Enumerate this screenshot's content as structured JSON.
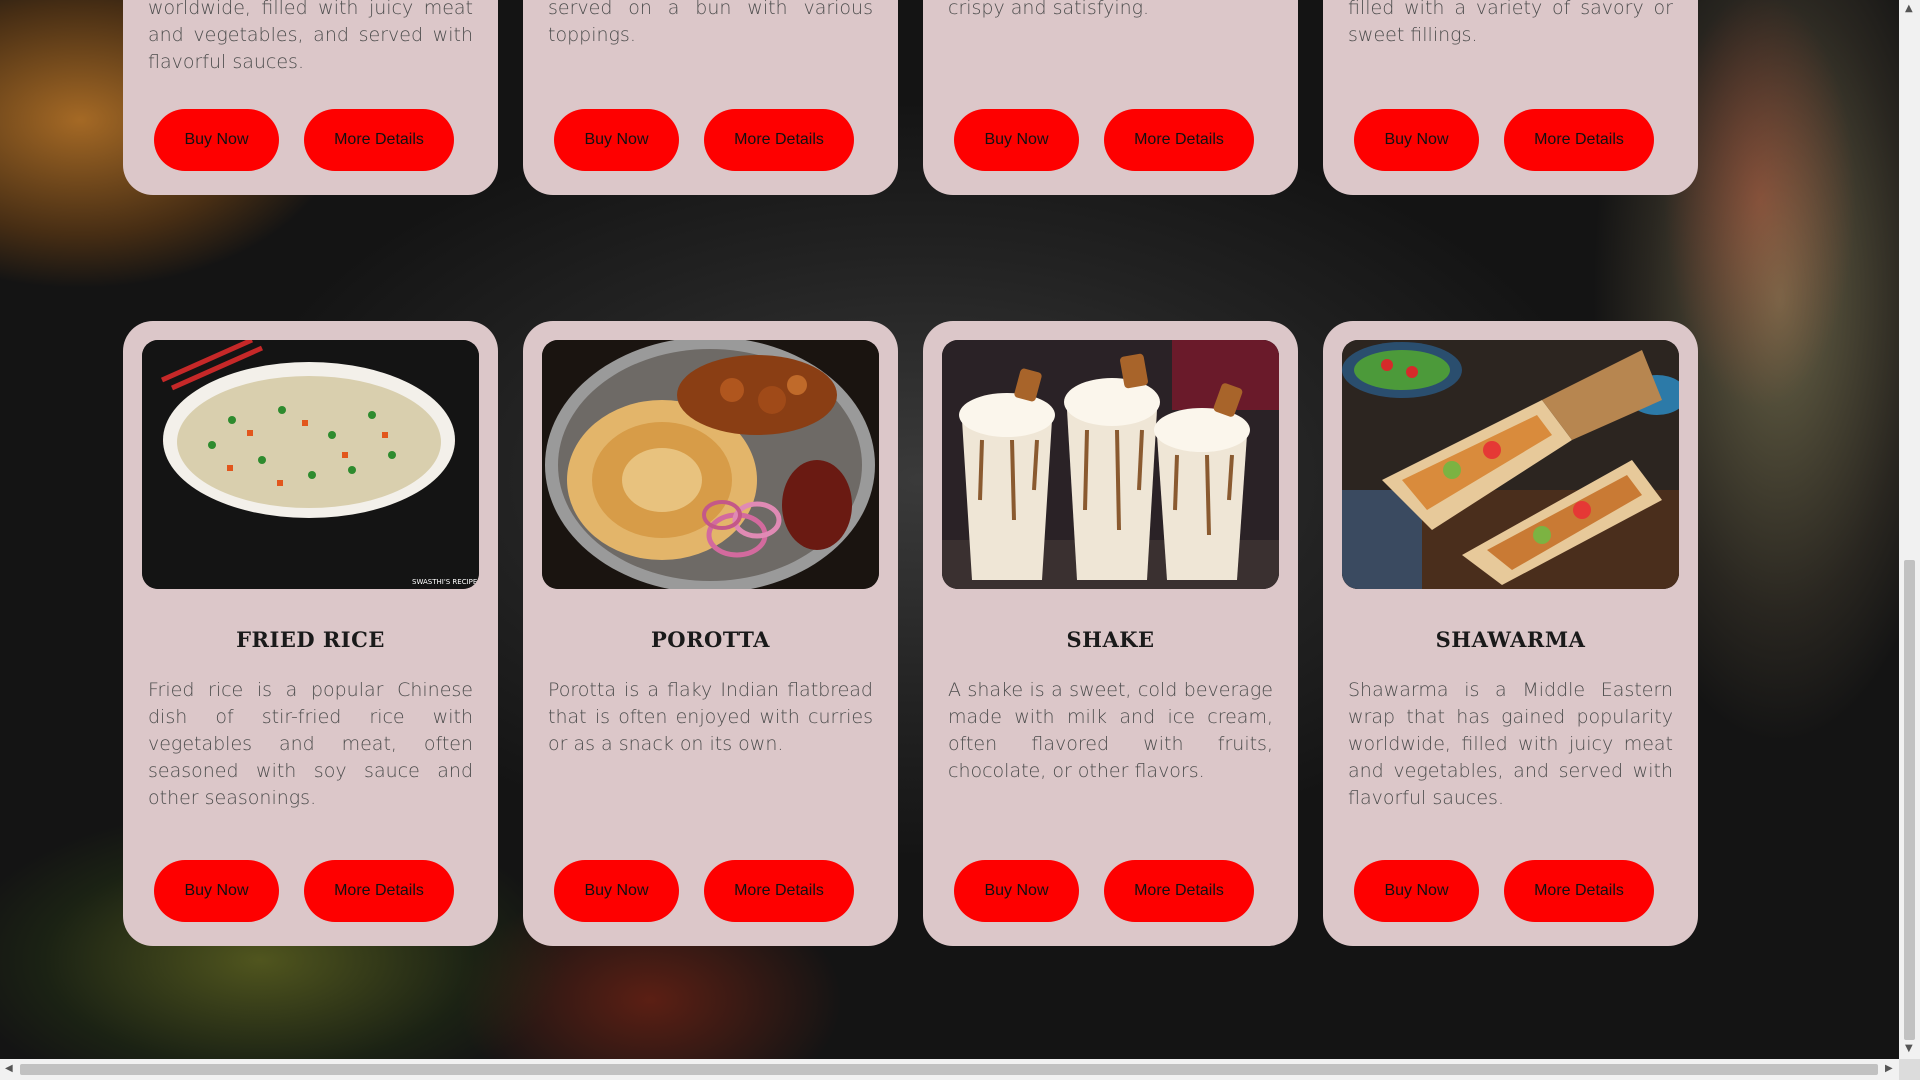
{
  "buttons": {
    "buy": "Buy Now",
    "more": "More Details"
  },
  "top_row": [
    {
      "desc": "worldwide, filled with juicy meat and vegetables, and served with flavorful sauces."
    },
    {
      "desc": "served on a bun with various toppings."
    },
    {
      "desc": "crispy and satisfying."
    },
    {
      "desc": "filled with a variety of savory or sweet fillings."
    }
  ],
  "cards": [
    {
      "title": "FRIED RICE",
      "image": "fried-rice-bowl-image",
      "desc": "Fried rice is a popular Chinese dish of stir-fried rice with vegetables and meat, often seasoned with soy sauce and other seasonings."
    },
    {
      "title": "POROTTA",
      "image": "porotta-plate-image",
      "desc": "Porotta is a flaky Indian flatbread that is often enjoyed with curries or as a snack on its own."
    },
    {
      "title": "SHAKE",
      "image": "milkshake-cups-image",
      "desc": "A shake is a sweet, cold beverage made with milk and ice cream, often flavored with fruits, chocolate, or other flavors."
    },
    {
      "title": "SHAWARMA",
      "image": "shawarma-wraps-image",
      "desc": "Shawarma is a Middle Eastern wrap that has gained popularity worldwide, filled with juicy meat and vegetables, and served with flavorful sauces."
    }
  ],
  "image_watermark": "SWASTHI'S RECIPES",
  "colors": {
    "card_bg": "#dcc7c9",
    "button": "#fe0000"
  }
}
